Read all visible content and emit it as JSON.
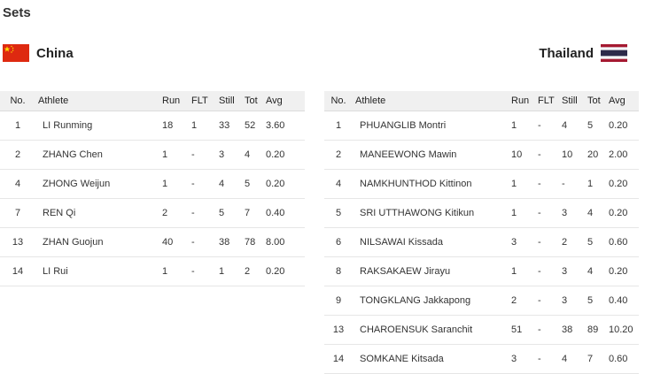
{
  "section_title": "Sets",
  "columns": {
    "no": "No.",
    "athlete": "Athlete",
    "run": "Run",
    "flt": "FLT",
    "still": "Still",
    "tot": "Tot",
    "avg": "Avg"
  },
  "teams": [
    {
      "name": "China",
      "flag": "china-flag",
      "players": [
        {
          "no": "1",
          "name": "LI Runming",
          "run": "18",
          "flt": "1",
          "still": "33",
          "tot": "52",
          "avg": "3.60"
        },
        {
          "no": "2",
          "name": "ZHANG Chen",
          "run": "1",
          "flt": "-",
          "still": "3",
          "tot": "4",
          "avg": "0.20"
        },
        {
          "no": "4",
          "name": "ZHONG Weijun",
          "run": "1",
          "flt": "-",
          "still": "4",
          "tot": "5",
          "avg": "0.20"
        },
        {
          "no": "7",
          "name": "REN Qi",
          "run": "2",
          "flt": "-",
          "still": "5",
          "tot": "7",
          "avg": "0.40"
        },
        {
          "no": "13",
          "name": "ZHAN Guojun",
          "run": "40",
          "flt": "-",
          "still": "38",
          "tot": "78",
          "avg": "8.00"
        },
        {
          "no": "14",
          "name": "LI Rui",
          "run": "1",
          "flt": "-",
          "still": "1",
          "tot": "2",
          "avg": "0.20"
        }
      ]
    },
    {
      "name": "Thailand",
      "flag": "thailand-flag",
      "players": [
        {
          "no": "1",
          "name": "PHUANGLIB Montri",
          "run": "1",
          "flt": "-",
          "still": "4",
          "tot": "5",
          "avg": "0.20"
        },
        {
          "no": "2",
          "name": "MANEEWONG Mawin",
          "run": "10",
          "flt": "-",
          "still": "10",
          "tot": "20",
          "avg": "2.00"
        },
        {
          "no": "4",
          "name": "NAMKHUNTHOD Kittinon",
          "run": "1",
          "flt": "-",
          "still": "-",
          "tot": "1",
          "avg": "0.20"
        },
        {
          "no": "5",
          "name": "SRI UTTHAWONG Kitikun",
          "run": "1",
          "flt": "-",
          "still": "3",
          "tot": "4",
          "avg": "0.20"
        },
        {
          "no": "6",
          "name": "NILSAWAI Kissada",
          "run": "3",
          "flt": "-",
          "still": "2",
          "tot": "5",
          "avg": "0.60"
        },
        {
          "no": "8",
          "name": "RAKSAKAEW Jirayu",
          "run": "1",
          "flt": "-",
          "still": "3",
          "tot": "4",
          "avg": "0.20"
        },
        {
          "no": "9",
          "name": "TONGKLANG Jakkapong",
          "run": "2",
          "flt": "-",
          "still": "3",
          "tot": "5",
          "avg": "0.40"
        },
        {
          "no": "13",
          "name": "CHAROENSUK Saranchit",
          "run": "51",
          "flt": "-",
          "still": "38",
          "tot": "89",
          "avg": "10.20"
        },
        {
          "no": "14",
          "name": "SOMKANE Kitsada",
          "run": "3",
          "flt": "-",
          "still": "4",
          "tot": "7",
          "avg": "0.60"
        }
      ]
    }
  ]
}
